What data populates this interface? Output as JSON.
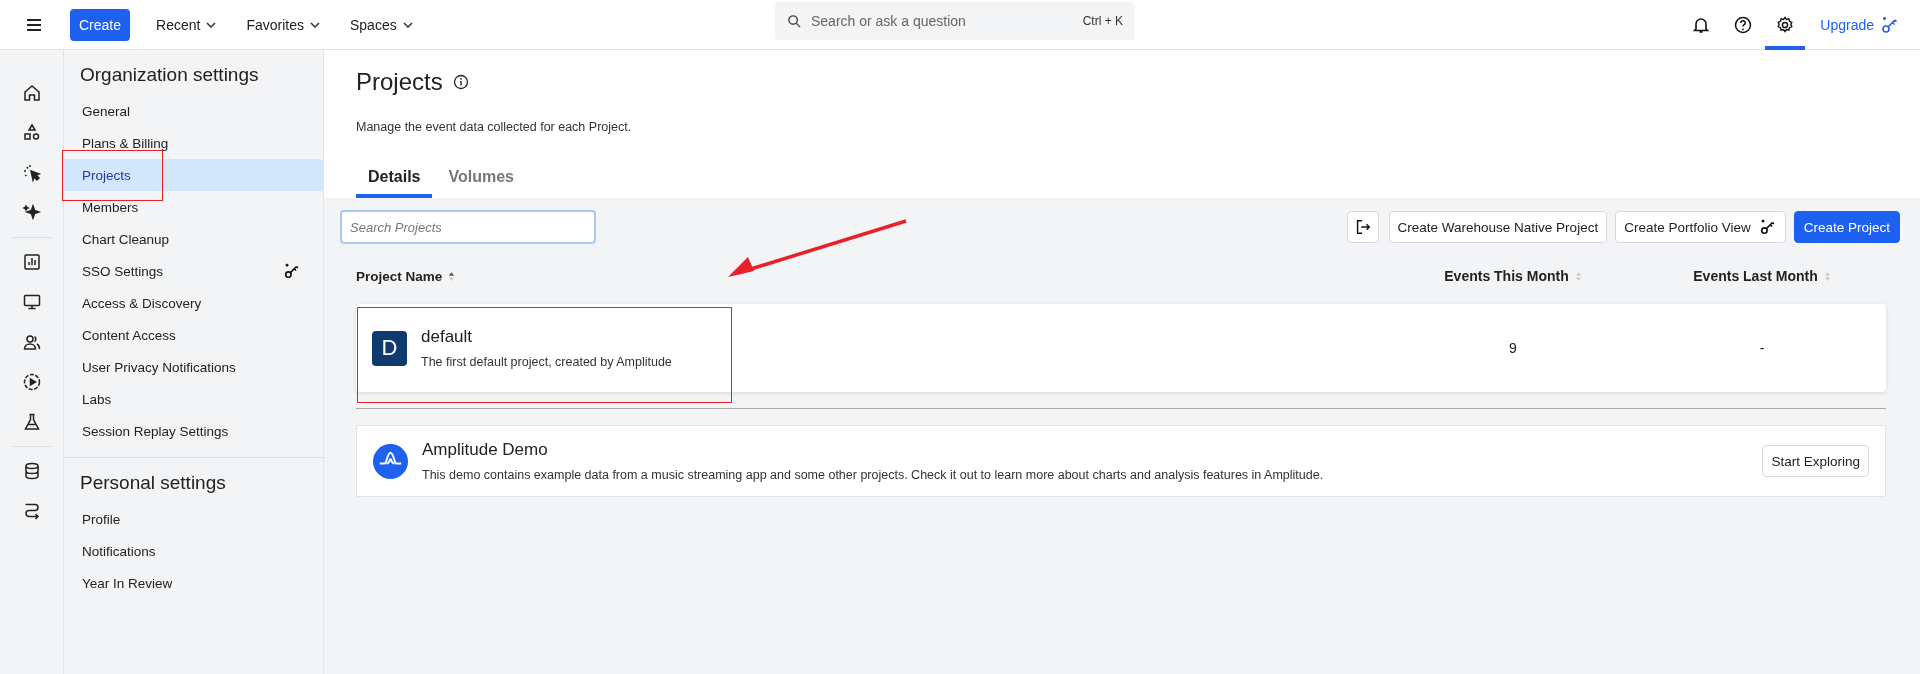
{
  "top_bar": {
    "create_button": "Create",
    "nav": [
      {
        "label": "Recent"
      },
      {
        "label": "Favorites"
      },
      {
        "label": "Spaces"
      }
    ],
    "search": {
      "placeholder": "Search or ask a question",
      "shortcut": "Ctrl + K"
    },
    "icons": [
      {
        "kind": "bell",
        "selected": false
      },
      {
        "kind": "help",
        "selected": false
      },
      {
        "kind": "settings",
        "selected": true
      }
    ],
    "upgrade": "Upgrade"
  },
  "sidebar": {
    "sections": [
      {
        "heading": "Organization settings",
        "items": [
          {
            "label": "General",
            "selected": false,
            "upgrade_badge": false
          },
          {
            "label": "Plans & Billing",
            "selected": false,
            "upgrade_badge": false
          },
          {
            "label": "Projects",
            "selected": true,
            "upgrade_badge": false
          },
          {
            "label": "Members",
            "selected": false,
            "upgrade_badge": false
          },
          {
            "label": "Chart Cleanup",
            "selected": false,
            "upgrade_badge": false
          },
          {
            "label": "SSO Settings",
            "selected": false,
            "upgrade_badge": true
          },
          {
            "label": "Access & Discovery",
            "selected": false,
            "upgrade_badge": false
          },
          {
            "label": "Content Access",
            "selected": false,
            "upgrade_badge": false
          },
          {
            "label": "User Privacy Notifications",
            "selected": false,
            "upgrade_badge": false
          },
          {
            "label": "Labs",
            "selected": false,
            "upgrade_badge": false
          },
          {
            "label": "Session Replay Settings",
            "selected": false,
            "upgrade_badge": false
          }
        ]
      },
      {
        "heading": "Personal settings",
        "items": [
          {
            "label": "Profile",
            "selected": false,
            "upgrade_badge": false
          },
          {
            "label": "Notifications",
            "selected": false,
            "upgrade_badge": false
          },
          {
            "label": "Year In Review",
            "selected": false,
            "upgrade_badge": false
          }
        ]
      }
    ]
  },
  "page": {
    "title": "Projects",
    "description": "Manage the event data collected for each Project.",
    "tabs": [
      {
        "label": "Details",
        "selected": true
      },
      {
        "label": "Volumes",
        "selected": false
      }
    ],
    "search": {
      "placeholder": "Search Projects"
    },
    "actions": [
      {
        "kind": "icon",
        "upgrade_badge": false
      },
      {
        "kind": "secondary",
        "label": "Create Warehouse Native Project",
        "upgrade_badge": false
      },
      {
        "kind": "secondary",
        "label": "Create Portfolio View",
        "upgrade_badge": true
      },
      {
        "kind": "primary",
        "label": "Create Project",
        "upgrade_badge": false
      }
    ]
  },
  "table": {
    "columns": [
      "Project Name",
      "Events This Month",
      "Events Last Month"
    ],
    "rows": [
      {
        "initial": "D",
        "name": "default",
        "description": "The first default project, created by Amplitude",
        "events_this_month": "9",
        "events_last_month": "-"
      }
    ]
  },
  "demo": {
    "name": "Amplitude Demo",
    "description": "This demo contains example data from a music streaming app and some other projects. Check it out to learn more about charts and analysis features in Amplitude.",
    "button": "Start Exploring"
  }
}
